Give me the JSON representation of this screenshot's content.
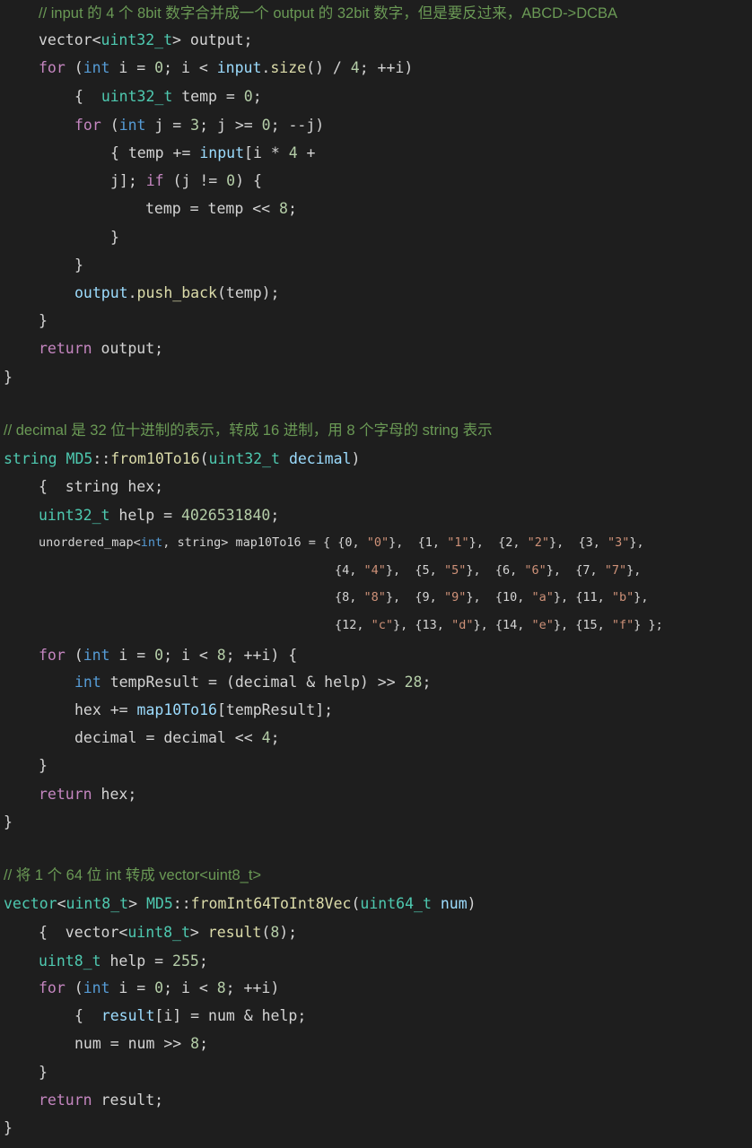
{
  "code": {
    "lines": [
      {
        "tokens": [
          [
            "cm",
            "// input 的 4 个 8bit 数字合并成一个 output 的 32bit 数字，但是要反过来，ABCD->DCBA"
          ]
        ]
      },
      {
        "tokens": [
          [
            "pl",
            "vector<"
          ],
          [
            "ty",
            "uint32_t"
          ],
          [
            "pl",
            "> output;"
          ]
        ]
      },
      {
        "tokens": [
          [
            "kw",
            "for"
          ],
          [
            "pl",
            " ("
          ],
          [
            "tk",
            "int"
          ],
          [
            "pl",
            " i = "
          ],
          [
            "num",
            "0"
          ],
          [
            "pl",
            "; i < "
          ],
          [
            "var",
            "input"
          ],
          [
            "pl",
            "."
          ],
          [
            "fn",
            "size"
          ],
          [
            "pl",
            "() / "
          ],
          [
            "num",
            "4"
          ],
          [
            "pl",
            "; ++i)"
          ]
        ]
      },
      {
        "tokens": [
          [
            "pl",
            "{  "
          ],
          [
            "ty",
            "uint32_t"
          ],
          [
            "pl",
            " temp = "
          ],
          [
            "num",
            "0"
          ],
          [
            "pl",
            ";"
          ]
        ]
      },
      {
        "tokens": [
          [
            "kw",
            "for"
          ],
          [
            "pl",
            " ("
          ],
          [
            "tk",
            "int"
          ],
          [
            "pl",
            " j = "
          ],
          [
            "num",
            "3"
          ],
          [
            "pl",
            "; j >= "
          ],
          [
            "num",
            "0"
          ],
          [
            "pl",
            "; --j)"
          ]
        ]
      },
      {
        "tokens": [
          [
            "pl",
            "{ temp += "
          ],
          [
            "var",
            "input"
          ],
          [
            "pl",
            "[i * "
          ],
          [
            "num",
            "4"
          ],
          [
            "pl",
            " +"
          ]
        ]
      },
      {
        "tokens": [
          [
            "pl",
            "j]; "
          ],
          [
            "kw",
            "if"
          ],
          [
            "pl",
            " (j != "
          ],
          [
            "num",
            "0"
          ],
          [
            "pl",
            ") {"
          ]
        ]
      },
      {
        "tokens": [
          [
            "pl",
            "temp = temp << "
          ],
          [
            "num",
            "8"
          ],
          [
            "pl",
            ";"
          ]
        ]
      },
      {
        "tokens": [
          [
            "pl",
            "}"
          ]
        ]
      },
      {
        "tokens": [
          [
            "pl",
            "}"
          ]
        ]
      },
      {
        "tokens": [
          [
            "var",
            "output"
          ],
          [
            "pl",
            "."
          ],
          [
            "fn",
            "push_back"
          ],
          [
            "pl",
            "(temp);"
          ]
        ]
      },
      {
        "tokens": [
          [
            "pl",
            "}"
          ]
        ]
      },
      {
        "tokens": [
          [
            "kw",
            "return"
          ],
          [
            "pl",
            " output;"
          ]
        ]
      },
      {
        "tokens": [
          [
            "pl",
            "}"
          ]
        ]
      },
      {
        "tokens": [
          [
            "cm",
            "// decimal 是 32 位十进制的表示，转成 16 进制，用 8 个字母的 string 表示"
          ]
        ]
      },
      {
        "tokens": [
          [
            "ty",
            "string"
          ],
          [
            "pl",
            " "
          ],
          [
            "ty",
            "MD5"
          ],
          [
            "pl",
            "::"
          ],
          [
            "fn",
            "from10To16"
          ],
          [
            "pl",
            "("
          ],
          [
            "ty",
            "uint32_t"
          ],
          [
            "pl",
            " "
          ],
          [
            "var",
            "decimal"
          ],
          [
            "pl",
            ")"
          ]
        ]
      },
      {
        "tokens": [
          [
            "pl",
            "{  string hex;"
          ]
        ]
      },
      {
        "tokens": [
          [
            "ty",
            "uint32_t"
          ],
          [
            "pl",
            " help = "
          ],
          [
            "num",
            "4026531840"
          ],
          [
            "pl",
            ";"
          ]
        ]
      },
      {
        "tokens": [
          [
            "pl",
            "unordered_map<"
          ],
          [
            "tk",
            "int"
          ],
          [
            "pl",
            ", string> map10To16 = { {0, "
          ],
          [
            "str",
            "\"0\""
          ],
          [
            "pl",
            "},  {1, "
          ],
          [
            "str",
            "\"1\""
          ],
          [
            "pl",
            "},  {2, "
          ],
          [
            "str",
            "\"2\""
          ],
          [
            "pl",
            "},  {3, "
          ],
          [
            "str",
            "\"3\""
          ],
          [
            "pl",
            "},"
          ]
        ]
      },
      {
        "tokens": [
          [
            "pl",
            "{4, "
          ],
          [
            "str",
            "\"4\""
          ],
          [
            "pl",
            "},  {5, "
          ],
          [
            "str",
            "\"5\""
          ],
          [
            "pl",
            "},  {6, "
          ],
          [
            "str",
            "\"6\""
          ],
          [
            "pl",
            "},  {7, "
          ],
          [
            "str",
            "\"7\""
          ],
          [
            "pl",
            "},"
          ]
        ]
      },
      {
        "tokens": [
          [
            "pl",
            "{8, "
          ],
          [
            "str",
            "\"8\""
          ],
          [
            "pl",
            "},  {9, "
          ],
          [
            "str",
            "\"9\""
          ],
          [
            "pl",
            "},  {10, "
          ],
          [
            "str",
            "\"a\""
          ],
          [
            "pl",
            "}, {11, "
          ],
          [
            "str",
            "\"b\""
          ],
          [
            "pl",
            "},"
          ]
        ]
      },
      {
        "tokens": [
          [
            "pl",
            "{12, "
          ],
          [
            "str",
            "\"c\""
          ],
          [
            "pl",
            "}, {13, "
          ],
          [
            "str",
            "\"d\""
          ],
          [
            "pl",
            "}, {14, "
          ],
          [
            "str",
            "\"e\""
          ],
          [
            "pl",
            "}, {15, "
          ],
          [
            "str",
            "\"f\""
          ],
          [
            "pl",
            "} };"
          ]
        ]
      },
      {
        "tokens": [
          [
            "kw",
            "for"
          ],
          [
            "pl",
            " ("
          ],
          [
            "tk",
            "int"
          ],
          [
            "pl",
            " i = "
          ],
          [
            "num",
            "0"
          ],
          [
            "pl",
            "; i < "
          ],
          [
            "num",
            "8"
          ],
          [
            "pl",
            "; ++i) {"
          ]
        ]
      },
      {
        "tokens": [
          [
            "tk",
            "int"
          ],
          [
            "pl",
            " tempResult = (decimal & help) >> "
          ],
          [
            "num",
            "28"
          ],
          [
            "pl",
            ";"
          ]
        ]
      },
      {
        "tokens": [
          [
            "pl",
            "hex += "
          ],
          [
            "var",
            "map10To16"
          ],
          [
            "pl",
            "[tempResult];"
          ]
        ]
      },
      {
        "tokens": [
          [
            "pl",
            "decimal = decimal << "
          ],
          [
            "num",
            "4"
          ],
          [
            "pl",
            ";"
          ]
        ]
      },
      {
        "tokens": [
          [
            "pl",
            "}"
          ]
        ]
      },
      {
        "tokens": [
          [
            "kw",
            "return"
          ],
          [
            "pl",
            " hex;"
          ]
        ]
      },
      {
        "tokens": [
          [
            "pl",
            "}"
          ]
        ]
      },
      {
        "tokens": [
          [
            "cm",
            "// 将 1 个 64 位 int 转成 vector<uint8_t>"
          ]
        ]
      },
      {
        "tokens": [
          [
            "ty",
            "vector"
          ],
          [
            "pl",
            "<"
          ],
          [
            "ty",
            "uint8_t"
          ],
          [
            "pl",
            "> "
          ],
          [
            "ty",
            "MD5"
          ],
          [
            "pl",
            "::"
          ],
          [
            "fn",
            "fromInt64ToInt8Vec"
          ],
          [
            "pl",
            "("
          ],
          [
            "ty",
            "uint64_t"
          ],
          [
            "pl",
            " "
          ],
          [
            "var",
            "num"
          ],
          [
            "pl",
            ")"
          ]
        ]
      },
      {
        "tokens": [
          [
            "pl",
            "{  vector<"
          ],
          [
            "ty",
            "uint8_t"
          ],
          [
            "pl",
            "> "
          ],
          [
            "fn",
            "result"
          ],
          [
            "pl",
            "("
          ],
          [
            "num",
            "8"
          ],
          [
            "pl",
            ");"
          ]
        ]
      },
      {
        "tokens": [
          [
            "ty",
            "uint8_t"
          ],
          [
            "pl",
            " help = "
          ],
          [
            "num",
            "255"
          ],
          [
            "pl",
            ";"
          ]
        ]
      },
      {
        "tokens": [
          [
            "kw",
            "for"
          ],
          [
            "pl",
            " ("
          ],
          [
            "tk",
            "int"
          ],
          [
            "pl",
            " i = "
          ],
          [
            "num",
            "0"
          ],
          [
            "pl",
            "; i < "
          ],
          [
            "num",
            "8"
          ],
          [
            "pl",
            "; ++i)"
          ]
        ]
      },
      {
        "tokens": [
          [
            "pl",
            "{  "
          ],
          [
            "var",
            "result"
          ],
          [
            "pl",
            "[i] = num & help;"
          ]
        ]
      },
      {
        "tokens": [
          [
            "pl",
            "num = num >> "
          ],
          [
            "num",
            "8"
          ],
          [
            "pl",
            ";"
          ]
        ]
      },
      {
        "tokens": [
          [
            "pl",
            "}"
          ]
        ]
      },
      {
        "tokens": [
          [
            "kw",
            "return"
          ],
          [
            "pl",
            " result;"
          ]
        ]
      },
      {
        "tokens": [
          [
            "pl",
            "}"
          ]
        ]
      }
    ]
  },
  "colors": {
    "background": "#1e1e1e",
    "plain": "#d4d4d4",
    "comment": "#6a9955",
    "keyword": "#c586c0",
    "type": "#4ec9b0",
    "builtin_type": "#569cd6",
    "variable": "#9cdcfe",
    "function": "#dcdcaa",
    "number": "#b5cea8",
    "string": "#ce9178"
  }
}
